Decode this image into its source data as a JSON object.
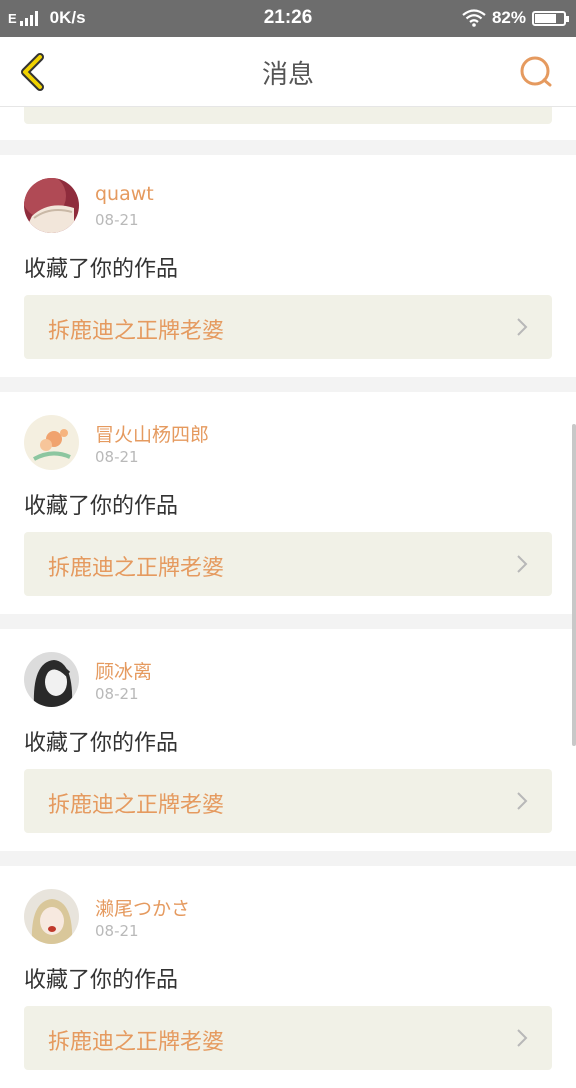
{
  "status_bar": {
    "network": "E",
    "speed": "0K/s",
    "time": "21:26",
    "battery_pct": "82%",
    "battery_level": 0.82
  },
  "header": {
    "title": "消息",
    "back_icon": "chevron-left-icon",
    "search_icon": "search-icon"
  },
  "colors": {
    "accent": "#e59a5f",
    "back_arrow": "#f0d200",
    "link_bg": "#f1f1e7"
  },
  "notifications": [
    {
      "username": "quawt",
      "date": "08-21",
      "action": "收藏了你的作品",
      "work_title": "拆鹿迪之正牌老婆"
    },
    {
      "username": "冒火山杨四郎",
      "date": "08-21",
      "action": "收藏了你的作品",
      "work_title": "拆鹿迪之正牌老婆"
    },
    {
      "username": "顾冰离",
      "date": "08-21",
      "action": "收藏了你的作品",
      "work_title": "拆鹿迪之正牌老婆"
    },
    {
      "username": "濑尾つかさ",
      "date": "08-21",
      "action": "收藏了你的作品",
      "work_title": "拆鹿迪之正牌老婆"
    }
  ]
}
